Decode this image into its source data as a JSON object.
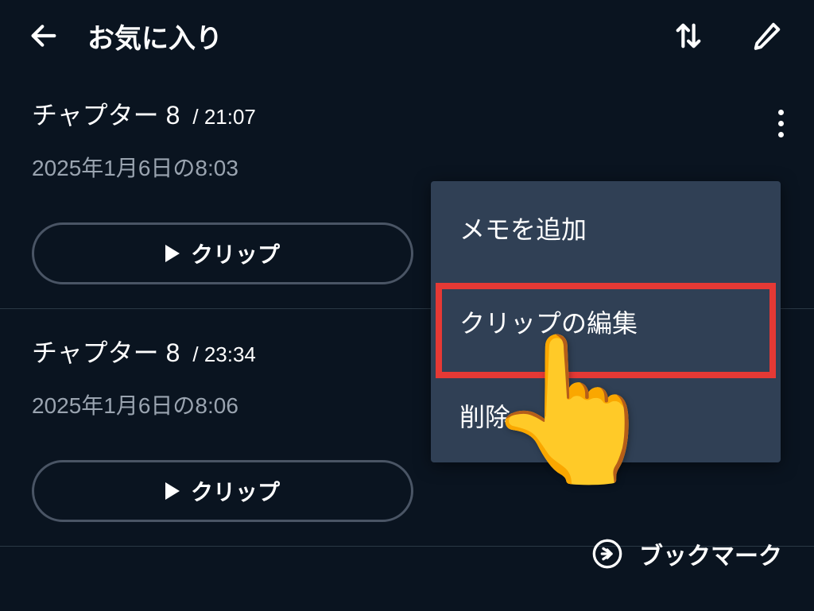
{
  "header": {
    "title": "お気に入り"
  },
  "items": [
    {
      "chapter": "チャプター 8",
      "time": "/ 21:07",
      "date": "2025年1月6日の8:03",
      "clip_label": "クリップ"
    },
    {
      "chapter": "チャプター 8",
      "time": "/ 23:34",
      "date": "2025年1月6日の8:06",
      "clip_label": "クリップ"
    }
  ],
  "menu": {
    "add_memo": "メモを追加",
    "edit_clip": "クリップの編集",
    "delete": "削除"
  },
  "bookmark_label": "ブックマーク"
}
